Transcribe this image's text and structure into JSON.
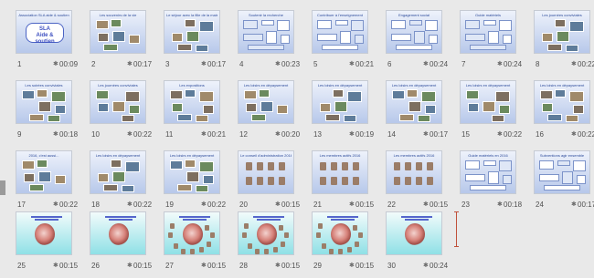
{
  "star_glyph": "✱",
  "slides": [
    {
      "number": "1",
      "duration": "00:09",
      "title": "Association SLA aide & soutien",
      "variant": "sla",
      "logo_lines": [
        "SLA",
        "Aide & soutien"
      ]
    },
    {
      "number": "2",
      "duration": "00:17",
      "title": "Les souvenirs de la vie",
      "variant": "collage"
    },
    {
      "number": "3",
      "duration": "00:17",
      "title": "Le séjour avec la fille de la maison",
      "variant": "collage"
    },
    {
      "number": "4",
      "duration": "00:23",
      "title": "Soutenir la recherche",
      "variant": "diagram"
    },
    {
      "number": "5",
      "duration": "00:21",
      "title": "Contribuer à l'enseignement",
      "variant": "diagram"
    },
    {
      "number": "6",
      "duration": "00:24",
      "title": "Engagement social",
      "variant": "diagram"
    },
    {
      "number": "7",
      "duration": "00:24",
      "title": "Guide matériels",
      "variant": "diagram"
    },
    {
      "number": "8",
      "duration": "00:22",
      "title": "Les journées conviviales",
      "variant": "collage"
    },
    {
      "number": "9",
      "duration": "00:18",
      "title": "Les soirées conviviales",
      "variant": "collage"
    },
    {
      "number": "10",
      "duration": "00:22",
      "title": "Les journées conviviales",
      "variant": "collage"
    },
    {
      "number": "11",
      "duration": "00:21",
      "title": "Les expositions",
      "variant": "collage"
    },
    {
      "number": "12",
      "duration": "00:20",
      "title": "Les loisirs en dépaysement",
      "variant": "collage"
    },
    {
      "number": "13",
      "duration": "00:19",
      "title": "Les loisirs en dépaysement",
      "variant": "collage"
    },
    {
      "number": "14",
      "duration": "00:17",
      "title": "Les loisirs en dépaysement",
      "variant": "collage"
    },
    {
      "number": "15",
      "duration": "00:22",
      "title": "Les loisirs en dépaysement",
      "variant": "collage"
    },
    {
      "number": "16",
      "duration": "00:22",
      "title": "Les loisirs en dépaysement",
      "variant": "collage"
    },
    {
      "number": "17",
      "duration": "00:22",
      "title": "2016, c'est aussi...",
      "variant": "collage"
    },
    {
      "number": "18",
      "duration": "00:22",
      "title": "Les loisirs en dépaysement",
      "variant": "collage"
    },
    {
      "number": "19",
      "duration": "00:22",
      "title": "Les loisirs en dépaysement",
      "variant": "collage"
    },
    {
      "number": "20",
      "duration": "00:15",
      "title": "Le conseil d'administration 2016",
      "variant": "faces"
    },
    {
      "number": "21",
      "duration": "00:15",
      "title": "Les membres actifs 2016",
      "variant": "faces"
    },
    {
      "number": "22",
      "duration": "00:15",
      "title": "Les membres actifs 2016",
      "variant": "faces"
    },
    {
      "number": "23",
      "duration": "00:18",
      "title": "Guide matériels en 2016",
      "variant": "diagram"
    },
    {
      "number": "24",
      "duration": "00:17",
      "title": "Subventions agir ensemble",
      "variant": "diagram"
    },
    {
      "number": "25",
      "duration": "00:15",
      "title": "",
      "variant": "baby"
    },
    {
      "number": "26",
      "duration": "00:15",
      "title": "",
      "variant": "baby"
    },
    {
      "number": "27",
      "duration": "00:15",
      "title": "",
      "variant": "babyfaces"
    },
    {
      "number": "28",
      "duration": "00:15",
      "title": "",
      "variant": "babyfaces"
    },
    {
      "number": "29",
      "duration": "00:15",
      "title": "",
      "variant": "babyfaces"
    },
    {
      "number": "30",
      "duration": "00:24",
      "title": "",
      "variant": "baby"
    }
  ]
}
